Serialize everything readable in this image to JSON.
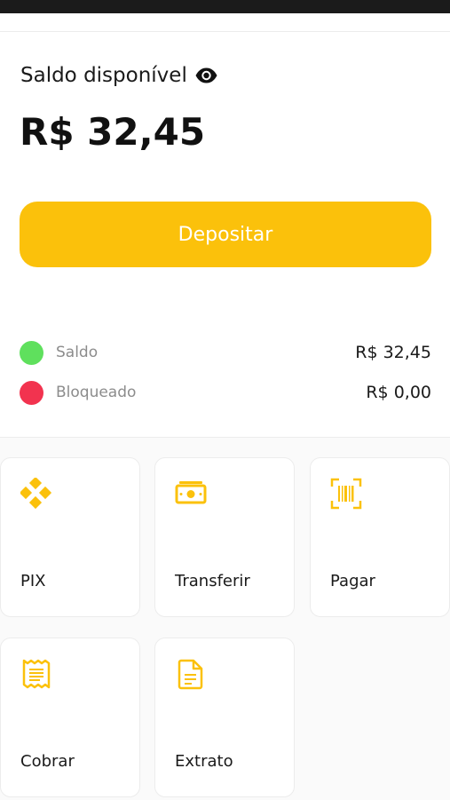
{
  "header": {
    "balance_title": "Saldo disponível",
    "balance_amount": "R$ 32,45",
    "visibility_icon": "eye-icon"
  },
  "deposit_button": {
    "label": "Depositar"
  },
  "breakdown": [
    {
      "label": "Saldo",
      "value": "R$ 32,45",
      "color": "#5fe05d"
    },
    {
      "label": "Bloqueado",
      "value": "R$ 0,00",
      "color": "#f2334f"
    }
  ],
  "actions": [
    {
      "label": "PIX",
      "icon": "pix-icon"
    },
    {
      "label": "Transferir",
      "icon": "money-icon"
    },
    {
      "label": "Pagar",
      "icon": "barcode-icon"
    },
    {
      "label": "Cobrar",
      "icon": "receipt-icon"
    },
    {
      "label": "Extrato",
      "icon": "document-icon"
    }
  ],
  "colors": {
    "accent": "#fbc10b",
    "text": "#1a1a1a",
    "muted": "#8c8c8c"
  }
}
